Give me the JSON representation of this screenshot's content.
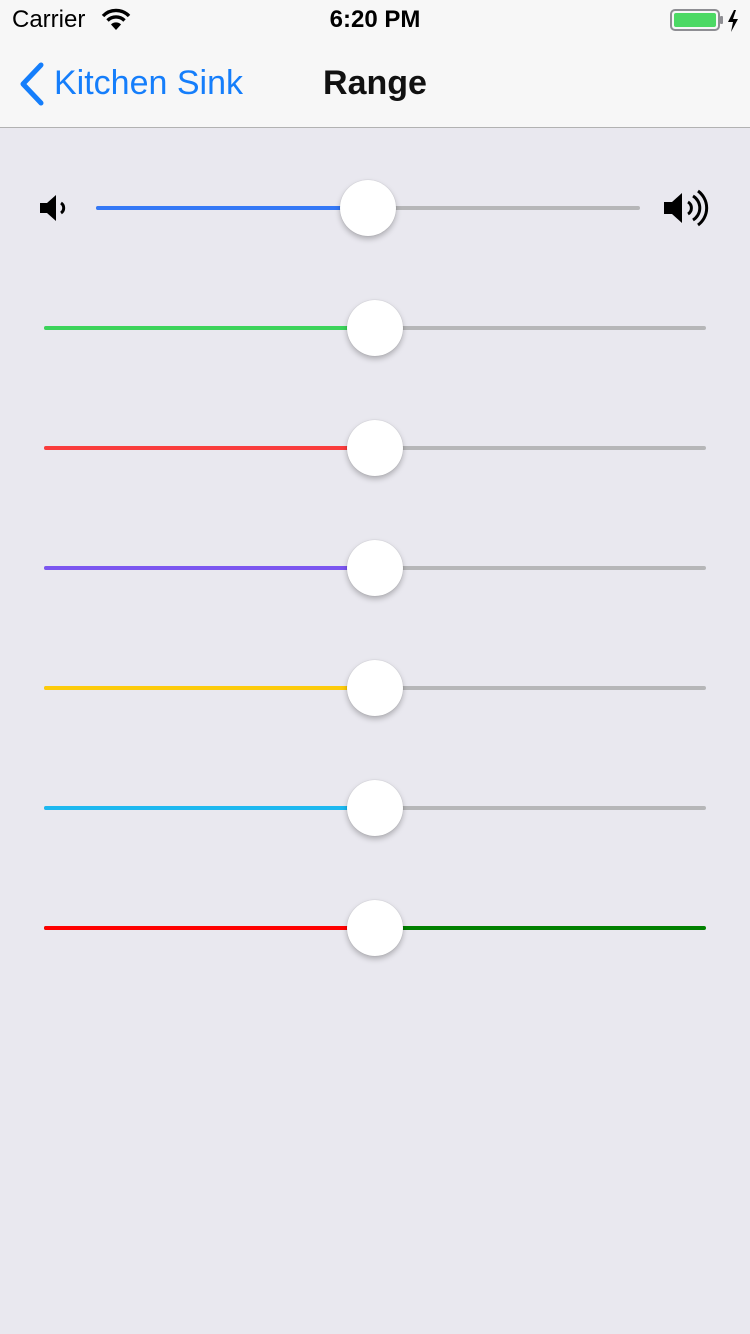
{
  "status_bar": {
    "carrier": "Carrier",
    "time": "6:20 PM",
    "icons": [
      "wifi-icon",
      "battery-icon",
      "charging-bolt-icon"
    ],
    "battery_color": "#4cd964"
  },
  "nav": {
    "back_label": "Kitchen Sink",
    "title": "Range",
    "accent_color": "#157efb"
  },
  "sliders": [
    {
      "name": "volume",
      "value": 0.5,
      "min_color": "#3478f6",
      "max_color": "#b6b6b8",
      "icons": [
        "volume-low-icon",
        "volume-high-icon"
      ]
    },
    {
      "name": "green",
      "value": 0.5,
      "min_color": "#3cd35b",
      "max_color": "#b6b6b8"
    },
    {
      "name": "red",
      "value": 0.5,
      "min_color": "#fa3c3c",
      "max_color": "#b6b6b8"
    },
    {
      "name": "purple",
      "value": 0.5,
      "min_color": "#7b56f0",
      "max_color": "#b6b6b8"
    },
    {
      "name": "yellow",
      "value": 0.5,
      "min_color": "#fdcb0b",
      "max_color": "#b6b6b8"
    },
    {
      "name": "cyan",
      "value": 0.5,
      "min_color": "#1db8f0",
      "max_color": "#b6b6b8"
    },
    {
      "name": "red-green",
      "value": 0.5,
      "min_color": "#ff0000",
      "max_color": "#008000"
    }
  ]
}
